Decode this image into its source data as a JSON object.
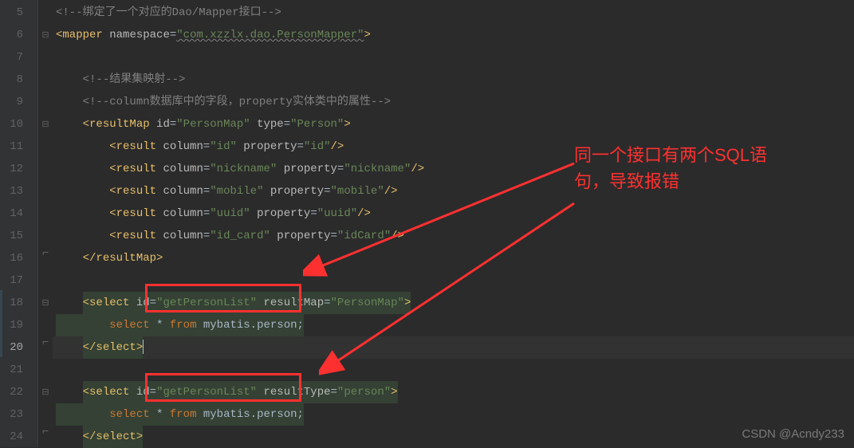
{
  "lines": {
    "start": 5,
    "end": 24,
    "current": 20
  },
  "code": {
    "l5": "<!--绑定了一个对应的Dao/Mapper接口-->",
    "l6_tag": "mapper",
    "l6_attr": "namespace",
    "l6_val": "\"com.xzzlx.dao.PersonMapper\"",
    "l8": "<!--结果集映射-->",
    "l9": "<!--column数据库中的字段，property实体类中的属性-->",
    "l10_tag": "resultMap",
    "l10_attrs": {
      "id": "\"PersonMap\"",
      "type": "\"Person\""
    },
    "results": [
      {
        "column": "\"id\"",
        "property": "\"id\""
      },
      {
        "column": "\"nickname\"",
        "property": "\"nickname\""
      },
      {
        "column": "\"mobile\"",
        "property": "\"mobile\""
      },
      {
        "column": "\"uuid\"",
        "property": "\"uuid\""
      },
      {
        "column": "\"id_card\"",
        "property": "\"idCard\""
      }
    ],
    "l16_close": "resultMap",
    "sel1_tag": "select",
    "sel1_id": "\"getPersonList\"",
    "sel1_map_attr": "resultMap",
    "sel1_map_val": "\"PersonMap\"",
    "sql_select": "select",
    "sql_star": "*",
    "sql_from": "from",
    "sql_table": "mybatis.person",
    "sql_semi": ";",
    "sel_close": "select",
    "sel2_tag": "select",
    "sel2_id": "\"getPersonList\"",
    "sel2_type_attr": "resultType",
    "sel2_type_val": "\"person\""
  },
  "annotation": {
    "line1": "同一个接口有两个SQL语",
    "line2": "句，导致报错"
  },
  "watermark": "CSDN @Acndy233"
}
